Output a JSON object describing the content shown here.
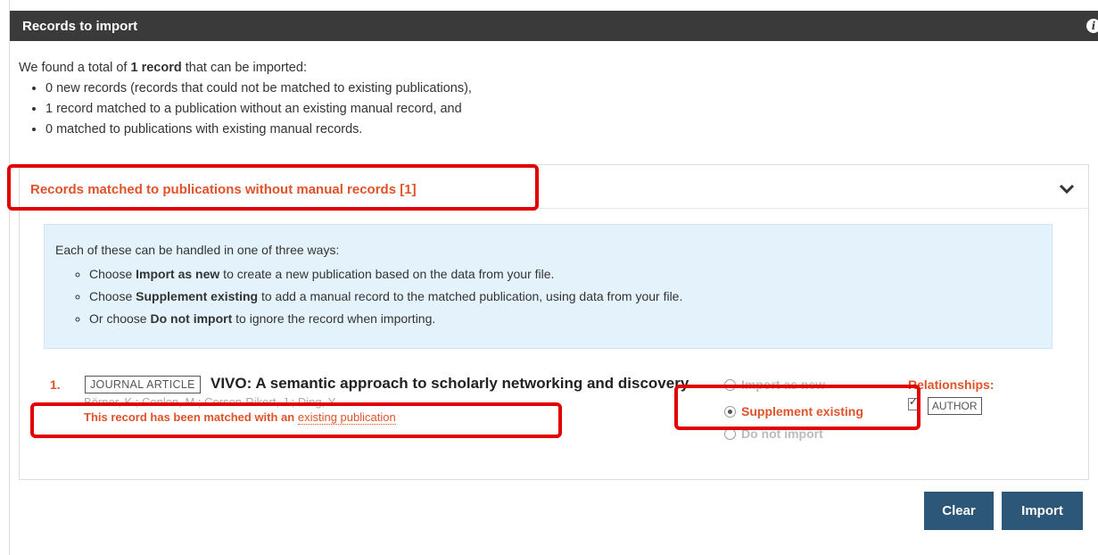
{
  "panel": {
    "title": "Records to import",
    "info_icon": "info-icon"
  },
  "summary": {
    "intro_prefix": "We found a total of ",
    "intro_count": "1 record",
    "intro_suffix": " that can be imported:",
    "items": [
      "0 new records (records that could not be matched to existing publications),",
      "1 record matched to a publication without an existing manual record, and",
      "0 matched to publications with existing manual records."
    ]
  },
  "section": {
    "title": "Records matched to publications without manual records [1]",
    "toggle_icon": "chevron-down-icon"
  },
  "help": {
    "intro": "Each of these can be handled in one of three ways:",
    "items": [
      {
        "prefix": "Choose ",
        "bold": "Import as new",
        "suffix": " to create a new publication based on the data from your file."
      },
      {
        "prefix": "Choose ",
        "bold": "Supplement existing",
        "suffix": " to add a manual record to the matched publication, using data from your file."
      },
      {
        "prefix": "Or choose ",
        "bold": "Do not import",
        "suffix": " to ignore the record when importing."
      }
    ]
  },
  "record": {
    "number": "1.",
    "type": "JOURNAL ARTICLE",
    "title": "VIVO: A semantic approach to scholarly networking and discovery",
    "authors": "Börner, K.; Conlon, M.; Corson-Rikert, J.; Ding, Y.",
    "match_text": "This record has been matched with an ",
    "match_link": "existing publication",
    "options": [
      {
        "label": "Import as new",
        "checked": false
      },
      {
        "label": "Supplement existing",
        "checked": true
      },
      {
        "label": "Do not import",
        "checked": false
      }
    ],
    "relationships_label": "Relationships:",
    "relationship_tag": "AUTHOR"
  },
  "buttons": {
    "clear": "Clear",
    "import": "Import"
  },
  "colors": {
    "header": "#3a3a3a",
    "accent": "#e0532a",
    "button": "#2d5779",
    "highlight": "#e00000",
    "help_bg": "#e4f3fb"
  }
}
